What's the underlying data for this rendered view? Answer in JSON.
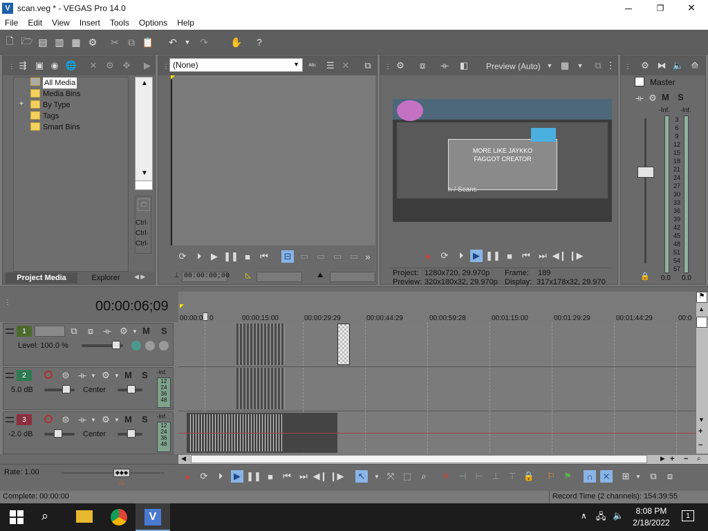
{
  "window": {
    "title": "scan.veg * - VEGAS Pro 14.0",
    "app_icon": "vegas-logo-icon",
    "minimize": "─",
    "restore": "❐",
    "close": "✕"
  },
  "menu": {
    "items": [
      "File",
      "Edit",
      "View",
      "Insert",
      "Tools",
      "Options",
      "Help"
    ]
  },
  "project_media": {
    "tree": [
      {
        "label": "All Media",
        "selected": true
      },
      {
        "label": "Media Bins"
      },
      {
        "label": "By Type",
        "expand": "+"
      },
      {
        "label": "Tags"
      },
      {
        "label": "Smart Bins"
      }
    ],
    "side_labels": [
      "Ctrl·",
      "Ctrl·",
      "Ctrl·"
    ],
    "tabs": [
      "Project Media",
      "Explorer"
    ]
  },
  "trimmer": {
    "dropdown_value": "(None)",
    "timecode": "00:00:00;00"
  },
  "preview": {
    "quality": "Preview (Auto)",
    "video_text_1": "MORE LIKE JAYKKO",
    "video_text_2": "FAGGOT CREATOR",
    "video_text_3": "n / Scans",
    "project_label": "Project:",
    "project_value": "1280x720, 29.970p",
    "frame_label": "Frame:",
    "frame_value": "189",
    "preview_label": "Preview:",
    "preview_value": "320x180x32, 29.970p",
    "display_label": "Display:",
    "display_value": "317x178x32, 29.970"
  },
  "mixer": {
    "title": "Master",
    "m": "M",
    "s": "S",
    "inf_left": "-Inf.",
    "inf_right": "-Inf.",
    "scale": [
      "3",
      "6",
      "9",
      "12",
      "15",
      "18",
      "21",
      "24",
      "27",
      "30",
      "33",
      "36",
      "39",
      "42",
      "45",
      "48",
      "51",
      "54",
      "57"
    ],
    "val_left": "0.0",
    "val_right": "0.0"
  },
  "timeline": {
    "cursor_time": "00:00:06;09",
    "ruler": [
      "00:00:0",
      "0",
      "00:00:15:00",
      "00:00:29:29",
      "00:00:44:29",
      "00:00:59:28",
      "00:01:15:00",
      "00:01:29:29",
      "00:01:44:29",
      "00:0"
    ],
    "tracks": [
      {
        "num": "1",
        "type": "video",
        "level": "Level: 100.0 %",
        "m": "M",
        "s": "S"
      },
      {
        "num": "2",
        "type": "audio",
        "vol": "5.0 dB",
        "pan": "Center",
        "m": "M",
        "s": "S",
        "meter": [
          "-Inf.",
          "12",
          "24",
          "36",
          "48"
        ]
      },
      {
        "num": "3",
        "type": "audio",
        "vol": "-2.0 dB",
        "pan": "Center",
        "m": "M",
        "s": "S",
        "meter": [
          "-Inf.",
          "12",
          "24",
          "36",
          "48"
        ]
      }
    ],
    "rate": "Rate: 1.00"
  },
  "status": {
    "left": "Complete: 00:00:00",
    "right": "Record Time (2 channels): 154:39:55"
  },
  "taskbar": {
    "time": "8:08 PM",
    "date": "2/18/2022",
    "notifications": "1"
  },
  "colors": {
    "track1": "#4d6a2e",
    "track2": "#2e7a52",
    "track3": "#8a2f3f",
    "play_highlight": "#8ab4e6",
    "meter_green": "#7fa28a"
  }
}
